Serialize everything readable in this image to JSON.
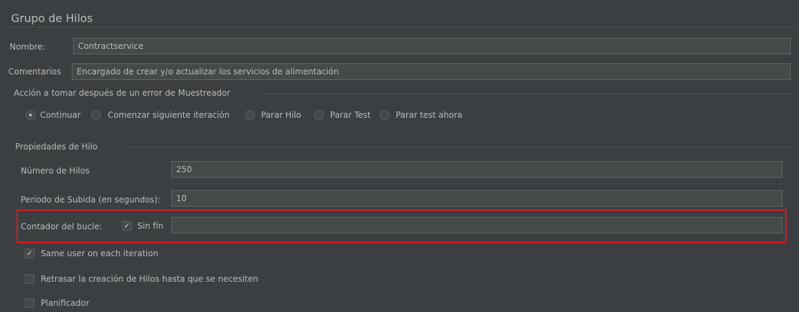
{
  "panel": {
    "title": "Grupo de Hilos"
  },
  "name": {
    "label": "Nombre:",
    "value": "Contractservice"
  },
  "comments": {
    "label": "Comentarios",
    "value": "Encargado de crear y/o actualizar los servicios de alimentación"
  },
  "error_action": {
    "legend": "Acción a tomar después de un error de Muestreador",
    "options": [
      {
        "label": "Continuar",
        "selected": true
      },
      {
        "label": "Comenzar siguiente iteración",
        "selected": false
      },
      {
        "label": "Parar Hilo",
        "selected": false
      },
      {
        "label": "Parar Test",
        "selected": false
      },
      {
        "label": "Parar test ahora",
        "selected": false
      }
    ]
  },
  "thread_props": {
    "legend": "Propiedades de Hilo",
    "num_threads": {
      "label": "Número de Hilos",
      "value": "250"
    },
    "ramp_up": {
      "label": "Periodo de Subida (en segundos):",
      "value": "10"
    },
    "loop_count": {
      "label": "Contador del bucle:",
      "infinite_label": "Sin fín",
      "infinite_checked": true,
      "value": ""
    },
    "same_user": {
      "label": "Same user on each iteration",
      "checked": true
    },
    "delay_creation": {
      "label": "Retrasar la creación de Hilos hasta que se necesiten",
      "checked": false
    },
    "scheduler": {
      "label": "Planificador",
      "checked": false
    }
  },
  "colors": {
    "background": "#3c3f41",
    "field": "#45494a",
    "highlight": "#e0191e"
  }
}
